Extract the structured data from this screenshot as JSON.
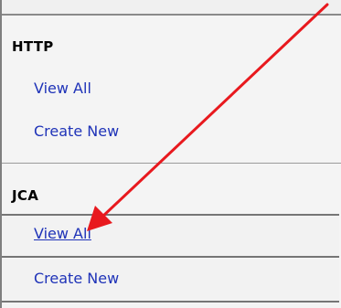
{
  "nav": {
    "sections": [
      {
        "heading": "HTTP",
        "links": [
          {
            "label": "View All"
          },
          {
            "label": "Create New"
          }
        ]
      },
      {
        "heading": "JCA",
        "links": [
          {
            "label": "View All"
          },
          {
            "label": "Create New"
          }
        ]
      }
    ]
  },
  "annotation": {
    "arrow_color": "#e8191e",
    "link_color": "#1f33b8"
  }
}
